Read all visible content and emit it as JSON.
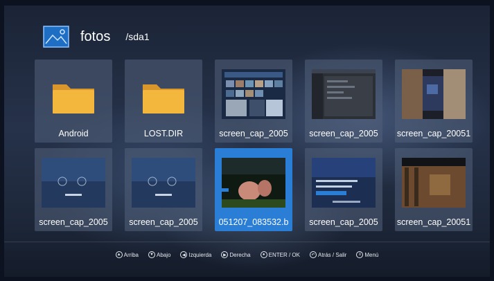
{
  "header": {
    "title": "fotos",
    "path": "/sda1",
    "icon": "image-icon"
  },
  "tiles": [
    {
      "label": "Android",
      "kind": "folder"
    },
    {
      "label": "LOST.DIR",
      "kind": "folder"
    },
    {
      "label": "screen_cap_2005",
      "kind": "image"
    },
    {
      "label": "screen_cap_2005",
      "kind": "image"
    },
    {
      "label": "screen_cap_20051",
      "kind": "image"
    },
    {
      "label": "screen_cap_2005",
      "kind": "image"
    },
    {
      "label": "screen_cap_2005",
      "kind": "image"
    },
    {
      "label": "051207_083532.b",
      "kind": "image",
      "selected": true
    },
    {
      "label": "screen_cap_2005",
      "kind": "image"
    },
    {
      "label": "screen_cap_20051",
      "kind": "image"
    }
  ],
  "hints": {
    "up": "Arriba",
    "down": "Abajo",
    "left": "Izquierda",
    "right": "Derecha",
    "ok": "ENTER / OK",
    "back": "Atrás / Salir",
    "menu": "Menú"
  },
  "colors": {
    "accent": "#2a7ed6",
    "folder": "#f2b33a"
  }
}
